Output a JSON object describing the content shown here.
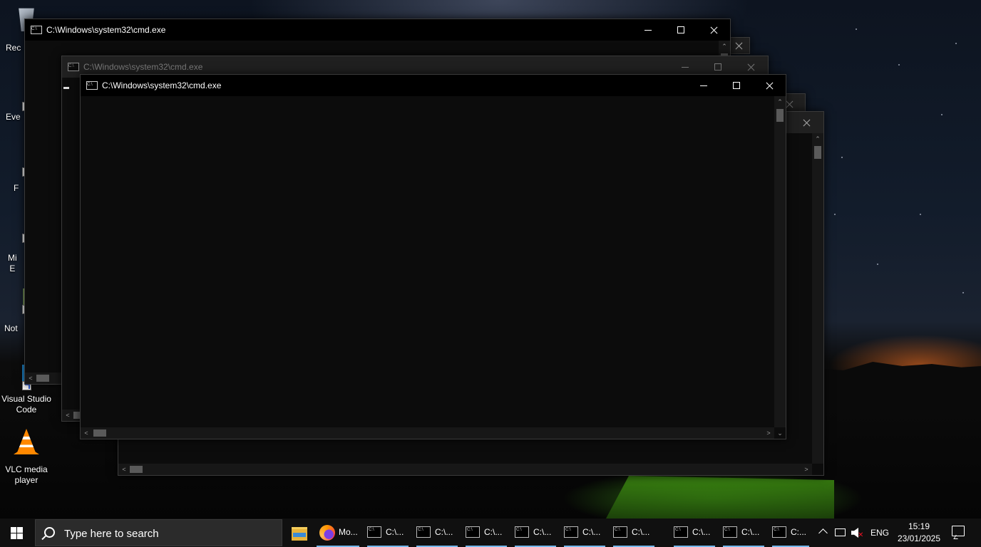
{
  "desktop": {
    "icons": [
      {
        "label": "Rec"
      },
      {
        "label": "Eve"
      },
      {
        "label": "F"
      },
      {
        "label": "Mi\nE"
      },
      {
        "label": "Not"
      },
      {
        "label": "Visual Studio\nCode"
      },
      {
        "label": "VLC media\nplayer"
      }
    ]
  },
  "windows": [
    {
      "title": "C:\\Windows\\system32\\cmd.exe",
      "state": "active-top-left"
    },
    {
      "title": "C:\\Windows\\system32\\cmd.exe",
      "state": "inactive"
    },
    {
      "title": "C:\\Windows\\system32\\cmd.exe",
      "state": "active-front"
    }
  ],
  "taskbar": {
    "search_placeholder": "Type here to search",
    "firefox_label": "Mo...",
    "cmd_items": [
      "C:\\...",
      "C:\\...",
      "C:\\...",
      "C:\\...",
      "C:\\...",
      "C:\\...",
      "C:\\...",
      "C:\\...",
      "C:..."
    ],
    "language": "ENG",
    "time": "15:19",
    "date": "23/01/2025"
  },
  "colors": {
    "titlebar_active": "#000000",
    "titlebar_inactive": "#202020",
    "console_bg": "#0c0c0c",
    "taskbar_bg": "#101010",
    "active_indicator": "#76b9ed"
  },
  "icons": [
    "windows-logo-icon",
    "search-icon",
    "file-explorer-icon",
    "firefox-icon",
    "cmd-icon",
    "chevron-up-icon",
    "network-icon",
    "volume-muted-icon",
    "notification-icon"
  ]
}
